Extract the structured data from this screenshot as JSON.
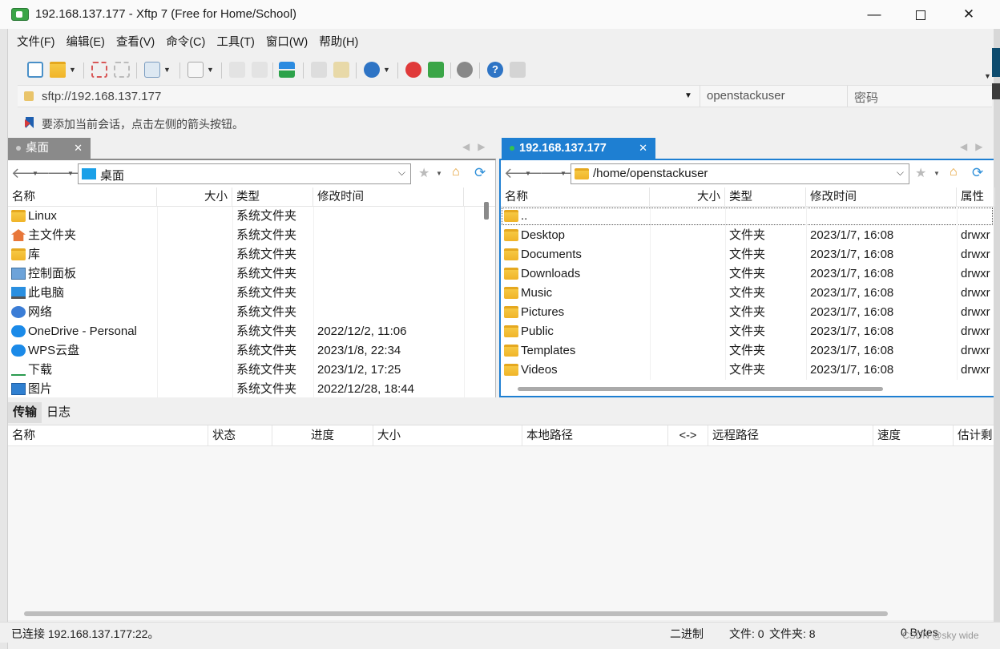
{
  "window": {
    "title": "192.168.137.177 - Xftp 7 (Free for Home/School)"
  },
  "menu": [
    "文件(F)",
    "编辑(E)",
    "查看(V)",
    "命令(C)",
    "工具(T)",
    "窗口(W)",
    "帮助(H)"
  ],
  "address": {
    "url": "sftp://192.168.137.177",
    "user": "openstackuser",
    "password_placeholder": "密码"
  },
  "hint": "要添加当前会话，点击左侧的箭头按钮。",
  "left_pane": {
    "tab": "桌面",
    "path": "桌面",
    "columns": [
      "名称",
      "大小",
      "类型",
      "修改时间"
    ],
    "rows": [
      {
        "name": "Linux",
        "size": "",
        "type": "系统文件夹",
        "modified": "",
        "icon": "folder-icon"
      },
      {
        "name": "主文件夹",
        "size": "",
        "type": "系统文件夹",
        "modified": "",
        "icon": "home-icon"
      },
      {
        "name": "库",
        "size": "",
        "type": "系统文件夹",
        "modified": "",
        "icon": "folder-icon"
      },
      {
        "name": "控制面板",
        "size": "",
        "type": "系统文件夹",
        "modified": "",
        "icon": "control-panel-icon"
      },
      {
        "name": "此电脑",
        "size": "",
        "type": "系统文件夹",
        "modified": "",
        "icon": "computer-icon"
      },
      {
        "name": "网络",
        "size": "",
        "type": "系统文件夹",
        "modified": "",
        "icon": "network-icon"
      },
      {
        "name": "OneDrive - Personal",
        "size": "",
        "type": "系统文件夹",
        "modified": "2022/12/2, 11:06",
        "icon": "cloud-icon"
      },
      {
        "name": "WPS云盘",
        "size": "",
        "type": "系统文件夹",
        "modified": "2023/1/8, 22:34",
        "icon": "cloud-icon"
      },
      {
        "name": "下载",
        "size": "",
        "type": "系统文件夹",
        "modified": "2023/1/2, 17:25",
        "icon": "download-icon"
      },
      {
        "name": "图片",
        "size": "",
        "type": "系统文件夹",
        "modified": "2022/12/28, 18:44",
        "icon": "picture-icon"
      }
    ]
  },
  "right_pane": {
    "tab": "192.168.137.177",
    "path": "/home/openstackuser",
    "columns": [
      "名称",
      "大小",
      "类型",
      "修改时间",
      "属性"
    ],
    "rows": [
      {
        "name": "..",
        "size": "",
        "type": "",
        "modified": "",
        "attr": ""
      },
      {
        "name": "Desktop",
        "size": "",
        "type": "文件夹",
        "modified": "2023/1/7, 16:08",
        "attr": "drwxr"
      },
      {
        "name": "Documents",
        "size": "",
        "type": "文件夹",
        "modified": "2023/1/7, 16:08",
        "attr": "drwxr"
      },
      {
        "name": "Downloads",
        "size": "",
        "type": "文件夹",
        "modified": "2023/1/7, 16:08",
        "attr": "drwxr"
      },
      {
        "name": "Music",
        "size": "",
        "type": "文件夹",
        "modified": "2023/1/7, 16:08",
        "attr": "drwxr"
      },
      {
        "name": "Pictures",
        "size": "",
        "type": "文件夹",
        "modified": "2023/1/7, 16:08",
        "attr": "drwxr"
      },
      {
        "name": "Public",
        "size": "",
        "type": "文件夹",
        "modified": "2023/1/7, 16:08",
        "attr": "drwxr"
      },
      {
        "name": "Templates",
        "size": "",
        "type": "文件夹",
        "modified": "2023/1/7, 16:08",
        "attr": "drwxr"
      },
      {
        "name": "Videos",
        "size": "",
        "type": "文件夹",
        "modified": "2023/1/7, 16:08",
        "attr": "drwxr"
      }
    ]
  },
  "bottom": {
    "tabs": [
      "传输",
      "日志"
    ],
    "columns": [
      "名称",
      "状态",
      "进度",
      "大小",
      "本地路径",
      "<->",
      "远程路径",
      "速度",
      "估计剩"
    ]
  },
  "status": {
    "connected": "已连接 192.168.137.177:22。",
    "mode": "二进制",
    "files": "文件: 0",
    "folders": "文件夹: 8",
    "bytes": "0 Bytes"
  },
  "watermark": "CSDN @sky wide",
  "colors": {
    "accent": "#1e7fd2",
    "folder": "#f0b429",
    "app": "#3aa547"
  }
}
